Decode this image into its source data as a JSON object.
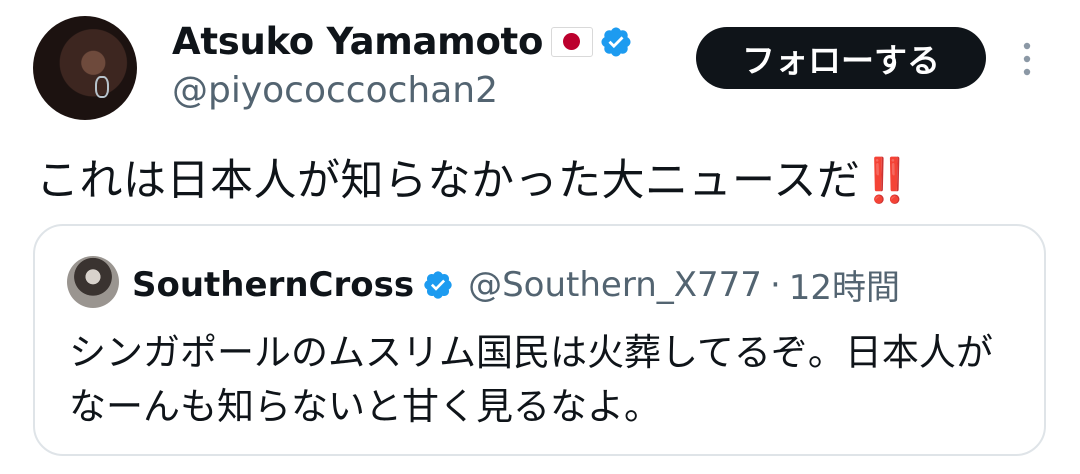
{
  "author": {
    "display_name": "Atsuko Yamamoto",
    "handle": "@piyococcochan2"
  },
  "follow_button": {
    "label": "フォローする"
  },
  "tweet": {
    "text": "これは日本人が知らなかった大ニュースだ",
    "emoji": "‼️"
  },
  "quoted_tweet": {
    "display_name": "SouthernCross",
    "handle": "@Southern_X777",
    "separator": "·",
    "time": "12時間",
    "text": "シンガポールのムスリム国民は火葬してるぞ。日本人がなーんも知らないと甘く見るなよ。"
  },
  "colors": {
    "verified": "#1d9bf0",
    "flag_red": "#bc002d",
    "secondary_text": "#536471",
    "button_bg": "#0f1419"
  }
}
